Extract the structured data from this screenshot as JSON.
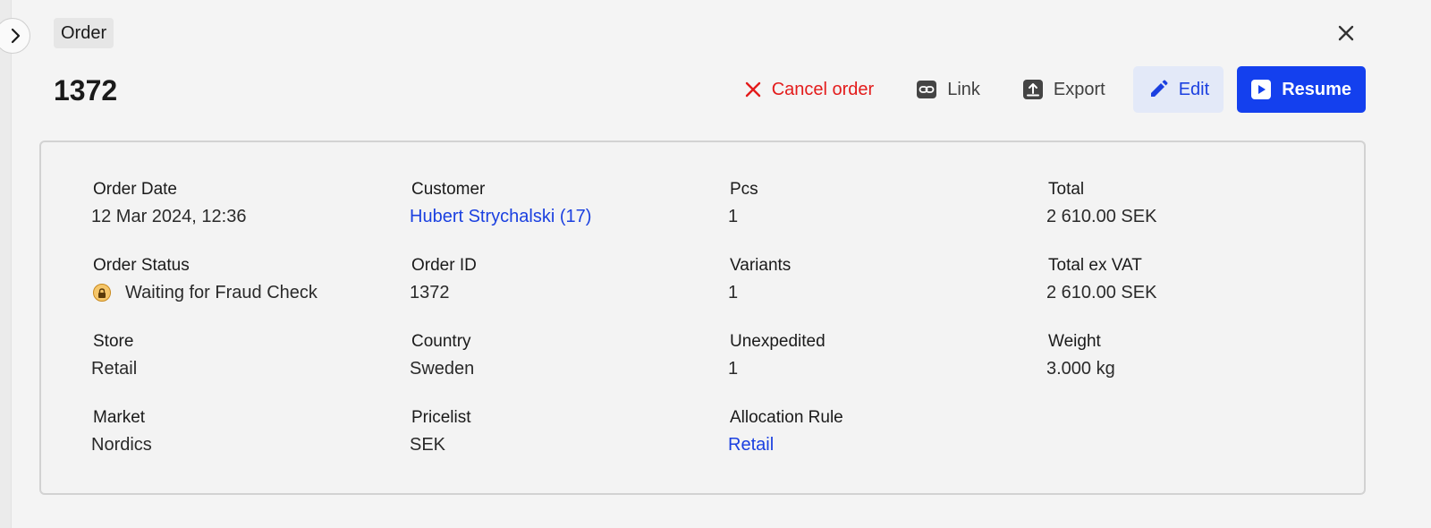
{
  "header": {
    "breadcrumb": "Order",
    "title": "1372"
  },
  "toolbar": {
    "cancel_label": "Cancel order",
    "link_label": "Link",
    "export_label": "Export",
    "edit_label": "Edit",
    "resume_label": "Resume"
  },
  "details": {
    "order_date": {
      "label": "Order Date",
      "value": "12 Mar 2024, 12:36"
    },
    "customer": {
      "label": "Customer",
      "value": "Hubert Strychalski (17)"
    },
    "pcs": {
      "label": "Pcs",
      "value": "1"
    },
    "total": {
      "label": "Total",
      "value": "2 610.00 SEK"
    },
    "order_status": {
      "label": "Order Status",
      "value": "Waiting for Fraud Check"
    },
    "order_id": {
      "label": "Order ID",
      "value": "1372"
    },
    "variants": {
      "label": "Variants",
      "value": "1"
    },
    "total_ex_vat": {
      "label": "Total ex VAT",
      "value": "2 610.00 SEK"
    },
    "store": {
      "label": "Store",
      "value": "Retail"
    },
    "country": {
      "label": "Country",
      "value": "Sweden"
    },
    "unexpedited": {
      "label": "Unexpedited",
      "value": "1"
    },
    "weight": {
      "label": "Weight",
      "value": "3.000 kg"
    },
    "market": {
      "label": "Market",
      "value": "Nordics"
    },
    "pricelist": {
      "label": "Pricelist",
      "value": "SEK"
    },
    "allocation_rule": {
      "label": "Allocation Rule",
      "value": "Retail"
    }
  },
  "icons": {
    "expand": "chevron-right-icon",
    "close": "close-icon",
    "cancel": "x-icon",
    "link": "link-icon",
    "export": "upload-icon",
    "edit": "pencil-icon",
    "resume": "play-icon",
    "status": "lock-icon"
  },
  "colors": {
    "primary": "#1440ee",
    "link": "#1b40e0",
    "danger": "#e31b1b",
    "edit_bg": "#e3e9f8",
    "status_badge": "#f5c66a"
  }
}
